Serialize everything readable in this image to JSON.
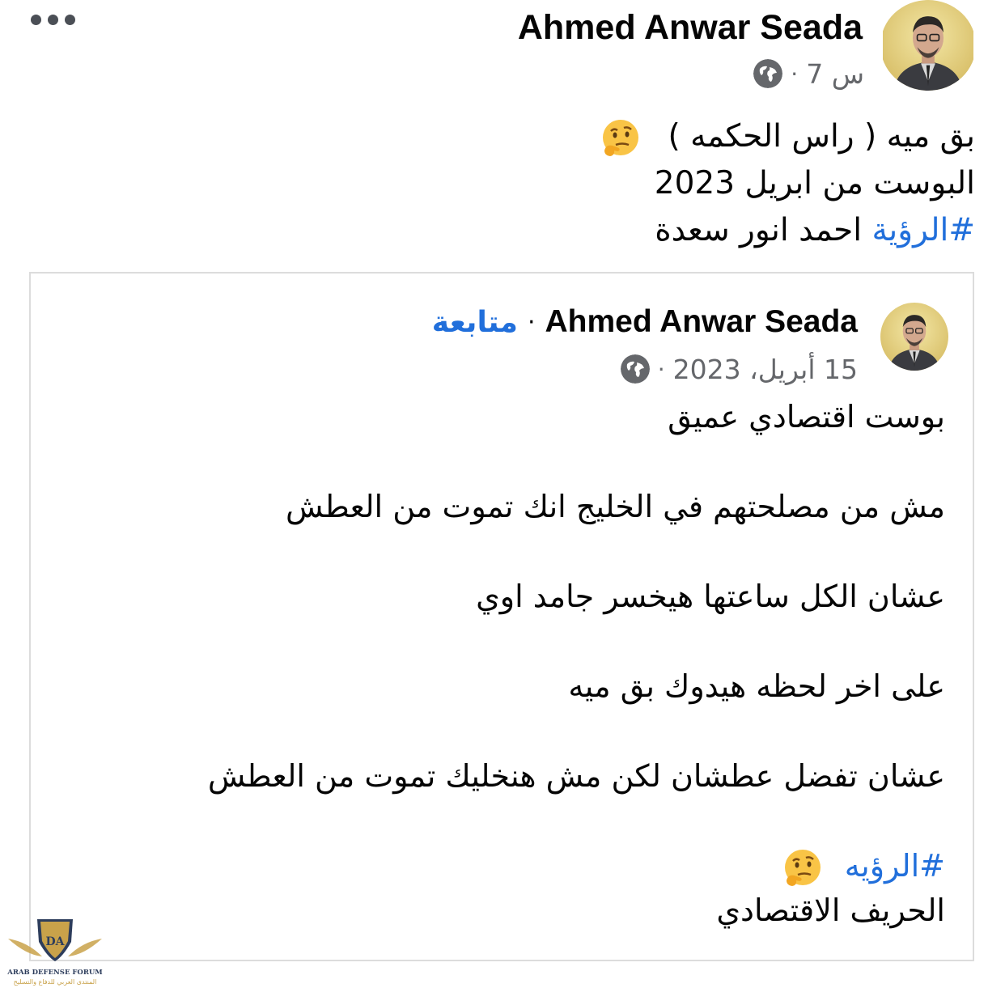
{
  "post": {
    "author": "Ahmed Anwar Seada",
    "time": "7 س",
    "dot": "·",
    "lines": [
      "بق ميه  ( راس الحكمه )",
      "البوست من ابريل  2023"
    ],
    "hashtag": "#الرؤية",
    "hashtag_suffix": " احمد انور سعدة",
    "emoji": "thinking-face"
  },
  "shared": {
    "author": "Ahmed Anwar Seada",
    "dot": "·",
    "follow": "متابعة",
    "date": "15 أبريل، 2023",
    "paragraphs": [
      "بوست اقتصادي عميق",
      "مش من مصلحتهم في الخليج انك تموت من العطش",
      "عشان الكل ساعتها هيخسر جامد اوي",
      "على اخر لحظه هيدوك بق ميه",
      "عشان تفضل عطشان لكن مش هنخليك تموت من العطش"
    ],
    "hashtag": "#الرؤيه",
    "signature": "الحريف الاقتصادي"
  },
  "watermark": {
    "logo": "DA",
    "name": "ARAB DEFENSE FORUM",
    "arabic": "المنتدى العربي للدفاع والتسليح"
  },
  "colors": {
    "link": "#216fdb",
    "meta": "#65676b",
    "border": "#dcdcdc"
  }
}
